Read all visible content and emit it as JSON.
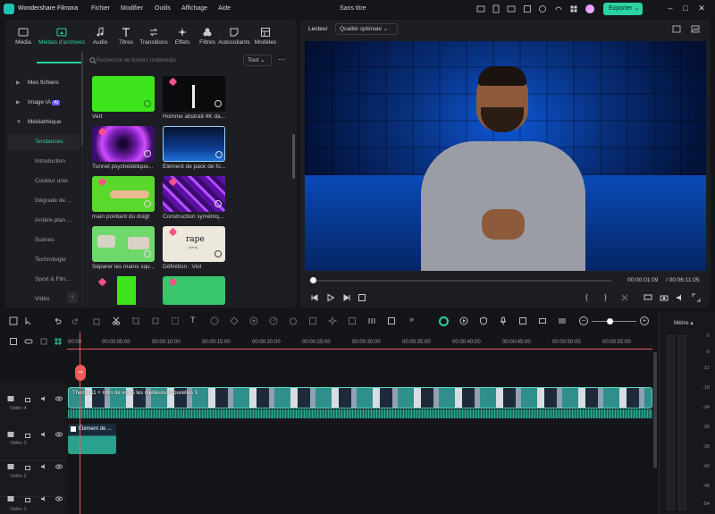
{
  "app": {
    "name": "Wondershare Filmora",
    "doc_title": "Sans titre",
    "export_label": "Exporter"
  },
  "menu": [
    "Fichier",
    "Modifier",
    "Outils",
    "Affichage",
    "Aide"
  ],
  "tabs": [
    {
      "label": "Média",
      "icon": "media-icon"
    },
    {
      "label": "Médias d'archives",
      "icon": "stock-media-icon",
      "active": true
    },
    {
      "label": "Audio",
      "icon": "music-note-icon"
    },
    {
      "label": "Titres",
      "icon": "text-icon"
    },
    {
      "label": "Transitions",
      "icon": "transition-icon"
    },
    {
      "label": "Effets",
      "icon": "effects-icon"
    },
    {
      "label": "Filtres",
      "icon": "filter-icon"
    },
    {
      "label": "Autocollants",
      "icon": "sticker-icon"
    },
    {
      "label": "Modèles",
      "icon": "template-icon"
    }
  ],
  "sidebar": {
    "items": [
      {
        "label": "Mes fichiers"
      },
      {
        "label": "Image IA",
        "badge": "AI"
      },
      {
        "label": "Médiathèque"
      }
    ],
    "subitems": [
      "Tendances",
      "Introduction",
      "Couleur unie",
      "Dégradé de ...",
      "Arrière-plan ...",
      "Scènes",
      "Technologie",
      "Sport & Fitn...",
      "Vidéo"
    ]
  },
  "search": {
    "placeholder": "Recherche de fichiers multimédia",
    "filter": "Tout"
  },
  "media_items": [
    {
      "label": "Vert",
      "color": "#3ee51c"
    },
    {
      "label": "Homme abstrait 4K da...",
      "color": "#0b0b0d"
    },
    {
      "label": "Tunnel psychédélique...",
      "color": "#7a1fb8"
    },
    {
      "label": "Élément de pack de fo...",
      "color": "#0e3a8c"
    },
    {
      "label": "main pointant du doigt",
      "color": "#5ad82b"
    },
    {
      "label": "Construction symétriq...",
      "color": "#8a2ad0"
    },
    {
      "label": "Séparer les mains squ...",
      "color": "#6fd86a"
    },
    {
      "label": "Définition : Viol",
      "color": "#ede8dc"
    },
    {
      "label": "",
      "color": "#3ee51c"
    },
    {
      "label": "",
      "color": "#39c56a"
    }
  ],
  "thumb_text": {
    "rape_word": "rape",
    "rape_sub": "[verb]"
  },
  "player": {
    "label": "Lecteur",
    "quality": "Qualité optimale",
    "current": "00:00:01:09",
    "total": "/ 00:06:11:05"
  },
  "ruler": [
    "00:00",
    "00:00:05:00",
    "00:00:10:00",
    "00:00:15:00",
    "00:00:20:00",
    "00:00:25:00",
    "00:00:30:00",
    "00:00:35:00",
    "00:00:40:00",
    "00:00:45:00",
    "00:00:50:00",
    "00:00:55:00"
  ],
  "tracks": [
    {
      "name": "Vidéo 4",
      "num": "4"
    },
    {
      "name": "Vidéo 3",
      "num": "3"
    },
    {
      "name": "Vidéo 2",
      "num": "2"
    },
    {
      "name": "Vidéo 1",
      "num": "1"
    }
  ],
  "clips": {
    "video4_title": "Thème 11 + Intro de vos 5 les meilleures nouvelles 5",
    "video3_title": "Élément de ..."
  },
  "meter": {
    "title": "Mètre",
    "levels": [
      "0",
      "-6",
      "-12",
      "-18",
      "-24",
      "-30",
      "-36",
      "-42",
      "-48",
      "-54"
    ]
  },
  "colors": {
    "accent": "#2ad3a2",
    "playhead": "#f15a5a",
    "badge": "#ff4f8a"
  }
}
